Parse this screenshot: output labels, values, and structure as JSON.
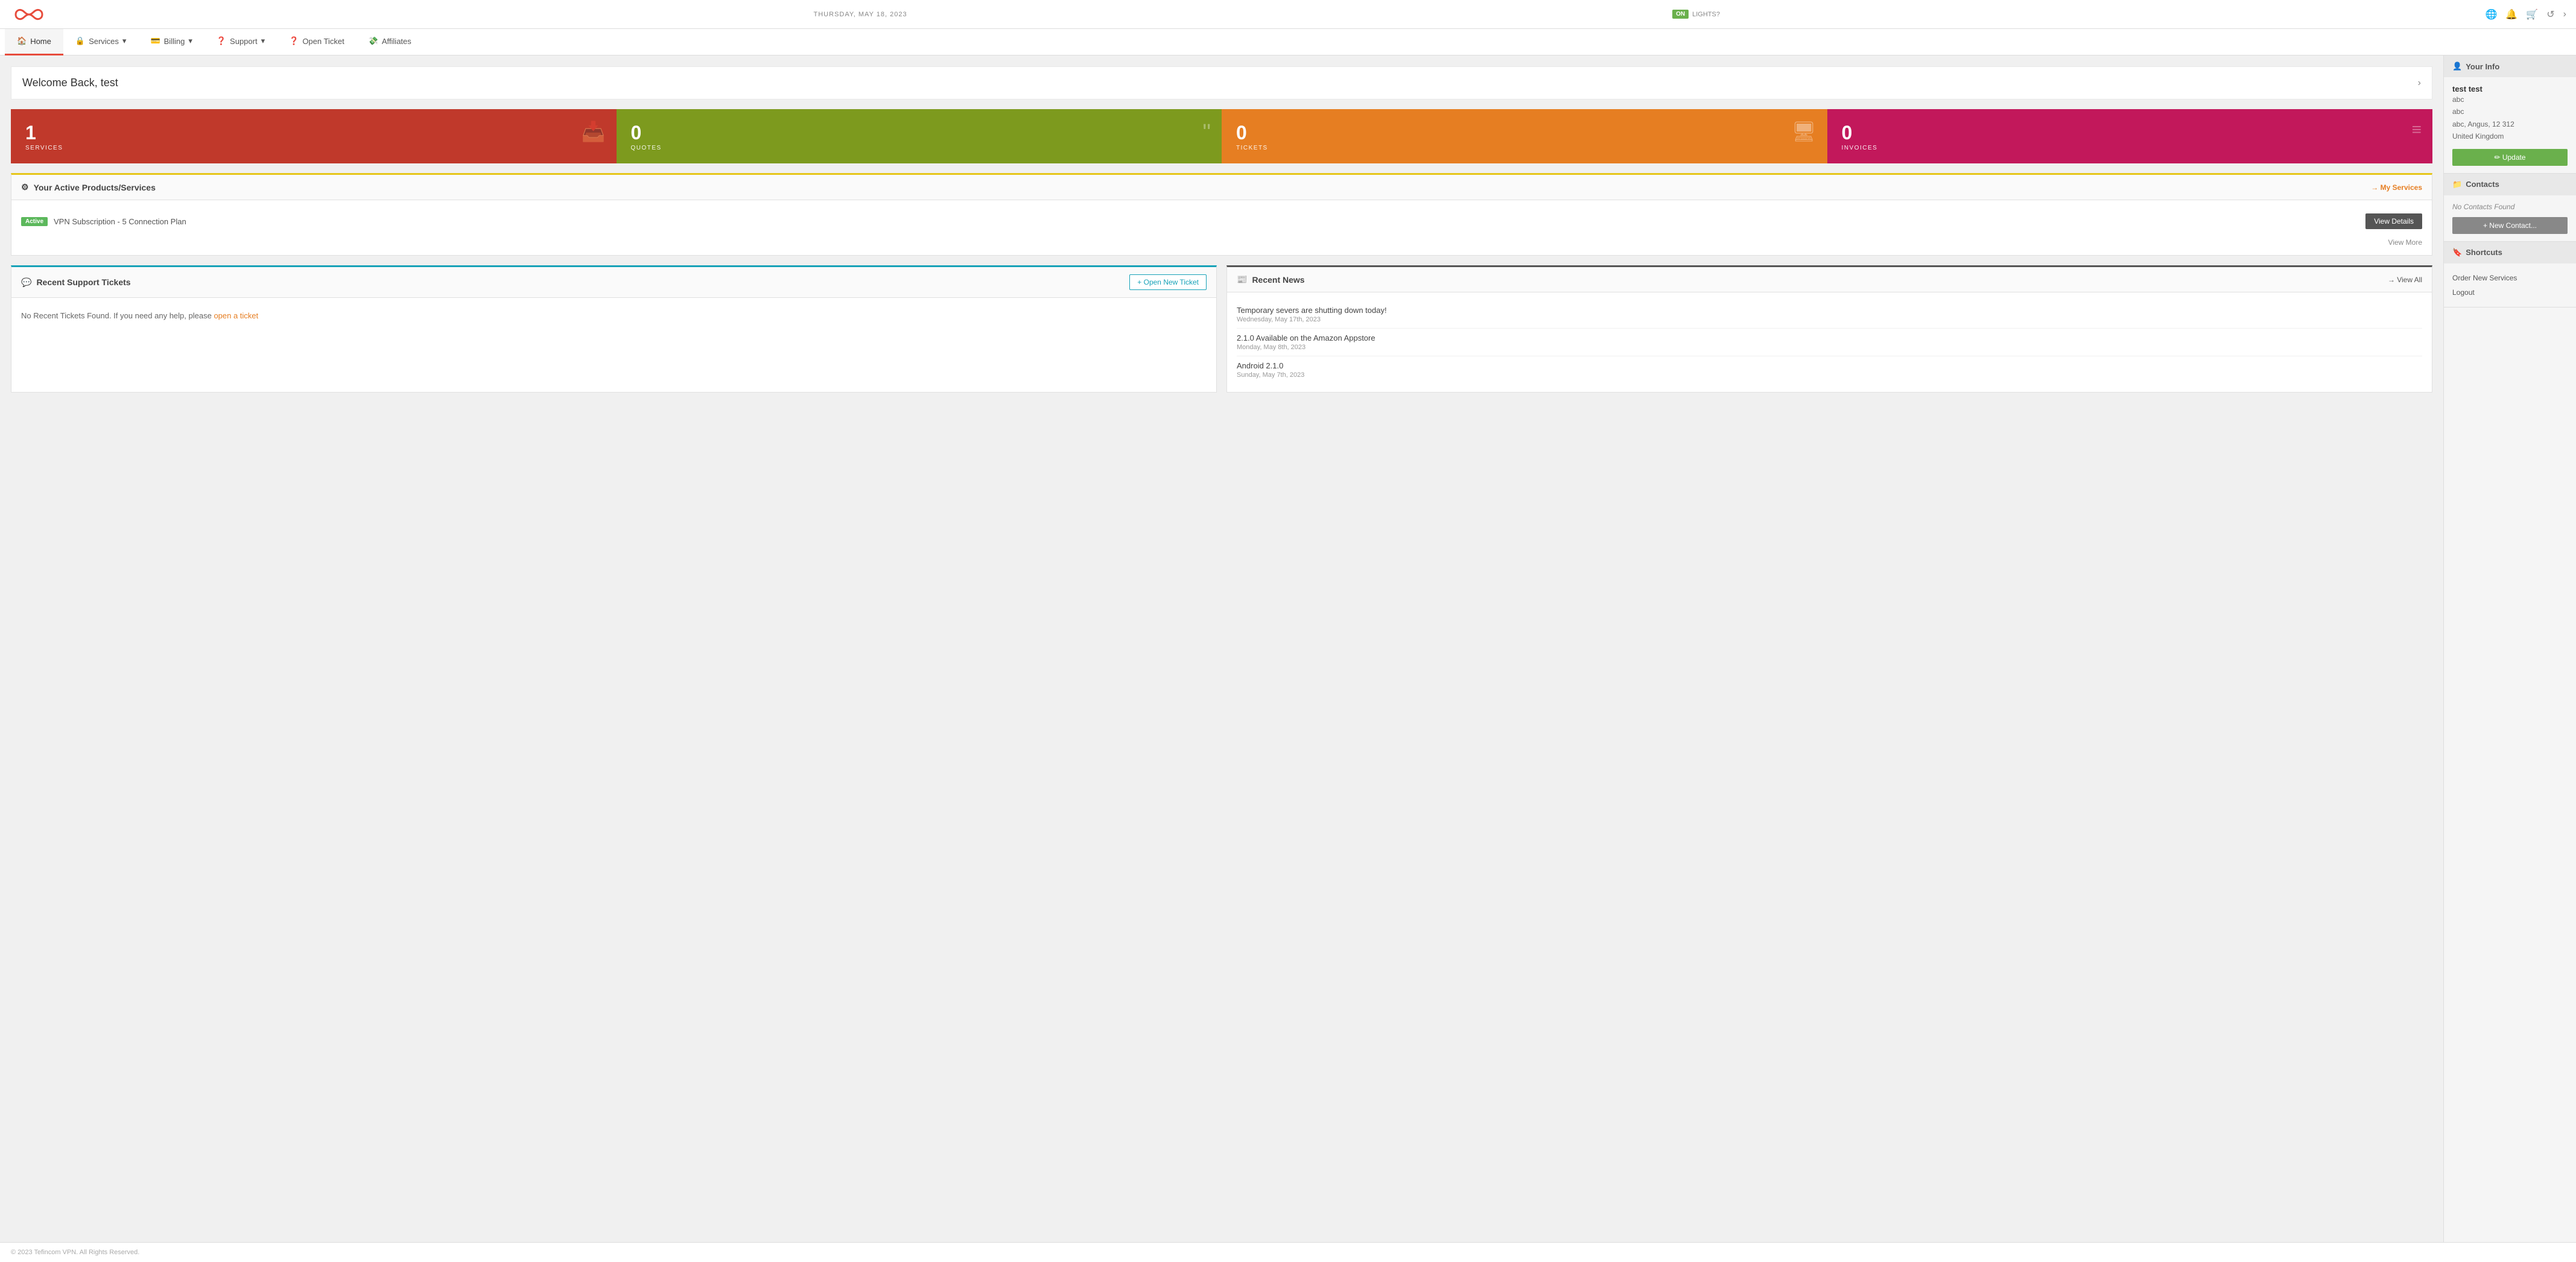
{
  "topbar": {
    "date": "THURSDAY, MAY 18, 2023",
    "lights_toggle": "ON",
    "lights_label": "LIGHTS?",
    "icons": {
      "translate": "🌐",
      "bell": "🔔",
      "cart": "🛒",
      "undo": "↺",
      "chevron": "›"
    }
  },
  "navbar": {
    "items": [
      {
        "label": "Home",
        "icon": "🏠",
        "active": true
      },
      {
        "label": "Services",
        "icon": "🔒",
        "dropdown": true
      },
      {
        "label": "Billing",
        "icon": "💳",
        "dropdown": true
      },
      {
        "label": "Support",
        "icon": "❓",
        "dropdown": true
      },
      {
        "label": "Open Ticket",
        "icon": "❓"
      },
      {
        "label": "Affiliates",
        "icon": "💸"
      }
    ]
  },
  "welcome": {
    "title": "Welcome Back, test",
    "arrow": "›"
  },
  "stat_cards": [
    {
      "number": "1",
      "label": "SERVICES",
      "icon": "📥",
      "color": "card-red"
    },
    {
      "number": "0",
      "label": "QUOTES",
      "icon": "❝",
      "color": "card-olive"
    },
    {
      "number": "0",
      "label": "TICKETS",
      "icon": "🖥",
      "color": "card-orange"
    },
    {
      "number": "0",
      "label": "INVOICES",
      "icon": "≡",
      "color": "card-pink"
    }
  ],
  "active_products": {
    "section_title": "Your Active Products/Services",
    "section_icon": "⚙",
    "my_services_label": "→ My Services",
    "product": {
      "status": "Active",
      "name": "VPN Subscription - 5 Connection Plan"
    },
    "view_details_label": "View Details",
    "view_more_label": "View More"
  },
  "support_tickets": {
    "section_title": "Recent Support Tickets",
    "section_icon": "💬",
    "open_ticket_label": "+ Open New Ticket",
    "no_tickets_text": "No Recent Tickets Found. If you need any help, please",
    "ticket_link_text": "open a ticket"
  },
  "recent_news": {
    "section_title": "Recent News",
    "section_icon": "📰",
    "view_all_label": "→ View All",
    "items": [
      {
        "title": "Temporary severs are shutting down today!",
        "date": "Wednesday, May 17th, 2023"
      },
      {
        "title": "2.1.0 Available on the Amazon Appstore",
        "date": "Monday, May 8th, 2023"
      },
      {
        "title": "Android 2.1.0",
        "date": "Sunday, May 7th, 2023"
      }
    ]
  },
  "sidebar": {
    "your_info": {
      "section_label": "Your Info",
      "icon": "👤",
      "name": "test test",
      "line1": "abc",
      "line2": "abc",
      "line3": "abc, Angus, 12 312",
      "line4": "United Kingdom",
      "update_label": "✏ Update"
    },
    "contacts": {
      "section_label": "Contacts",
      "icon": "📁",
      "no_contacts": "No Contacts Found",
      "new_contact_label": "+ New Contact..."
    },
    "shortcuts": {
      "section_label": "Shortcuts",
      "icon": "🔖",
      "items": [
        {
          "label": "Order New Services"
        },
        {
          "label": "Logout"
        }
      ]
    }
  },
  "footer": {
    "text": "© 2023 Tefincom VPN. All Rights Reserved."
  }
}
